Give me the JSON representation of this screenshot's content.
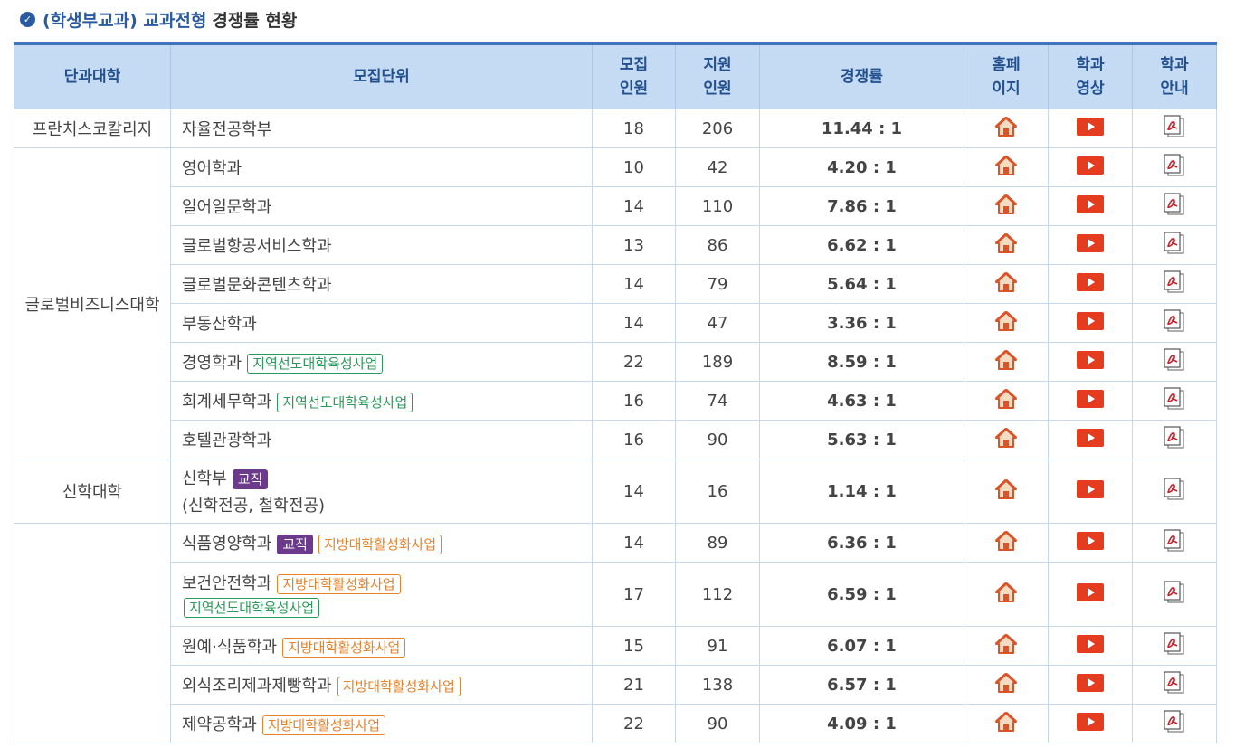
{
  "title": {
    "prefix": "(학생부교과) 교과전형",
    "suffix": "경쟁률 현황"
  },
  "headers": {
    "college": "단과대학",
    "unit": "모집단위",
    "quota_1": "모집",
    "quota_2": "인원",
    "applicants_1": "지원",
    "applicants_2": "인원",
    "rate": "경쟁률",
    "home_1": "홈페",
    "home_2": "이지",
    "video_1": "학과",
    "video_2": "영상",
    "guide_1": "학과",
    "guide_2": "안내"
  },
  "colors": {
    "header_bg": "#c5dbf3",
    "header_text": "#23508f",
    "top_border": "#3f73bb",
    "badge_green": "#2a9a5a",
    "badge_orange": "#e6822c",
    "badge_purple": "#6b3a8c",
    "home_icon": "#e0602a",
    "video_icon": "#e53b1f"
  },
  "icons": {
    "home": "home-icon",
    "video": "video-play-icon",
    "guide": "pdf-document-icon"
  },
  "colleges": [
    "프란치스코칼리지",
    "글로벌비즈니스대학",
    "신학대학",
    ""
  ],
  "rows": [
    {
      "college": "프란치스코칼리지",
      "dept": "자율전공학부",
      "quota": "18",
      "applicants": "206",
      "rate": "11.44 : 1",
      "badges": []
    },
    {
      "college": "글로벌비즈니스대학",
      "dept": "영어학과",
      "quota": "10",
      "applicants": "42",
      "rate": "4.20 : 1",
      "badges": []
    },
    {
      "college": "글로벌비즈니스대학",
      "dept": "일어일문학과",
      "quota": "14",
      "applicants": "110",
      "rate": "7.86 : 1",
      "badges": []
    },
    {
      "college": "글로벌비즈니스대학",
      "dept": "글로벌항공서비스학과",
      "quota": "13",
      "applicants": "86",
      "rate": "6.62 : 1",
      "badges": []
    },
    {
      "college": "글로벌비즈니스대학",
      "dept": "글로벌문화콘텐츠학과",
      "quota": "14",
      "applicants": "79",
      "rate": "5.64 : 1",
      "badges": []
    },
    {
      "college": "글로벌비즈니스대학",
      "dept": "부동산학과",
      "quota": "14",
      "applicants": "47",
      "rate": "3.36 : 1",
      "badges": []
    },
    {
      "college": "글로벌비즈니스대학",
      "dept": "경영학과",
      "quota": "22",
      "applicants": "189",
      "rate": "8.59 : 1",
      "badges": [
        {
          "text": "지역선도대학육성사업",
          "style": "green"
        }
      ]
    },
    {
      "college": "글로벌비즈니스대학",
      "dept": "회계세무학과",
      "quota": "16",
      "applicants": "74",
      "rate": "4.63 : 1",
      "badges": [
        {
          "text": "지역선도대학육성사업",
          "style": "green"
        }
      ]
    },
    {
      "college": "글로벌비즈니스대학",
      "dept": "호텔관광학과",
      "quota": "16",
      "applicants": "90",
      "rate": "5.63 : 1",
      "badges": []
    },
    {
      "college": "신학대학",
      "dept": "신학부",
      "dept_note": "(신학전공, 철학전공)",
      "quota": "14",
      "applicants": "16",
      "rate": "1.14 : 1",
      "badges": [
        {
          "text": "교직",
          "style": "purple"
        }
      ]
    },
    {
      "college": "",
      "dept": "식품영양학과",
      "quota": "14",
      "applicants": "89",
      "rate": "6.36 : 1",
      "badges": [
        {
          "text": "교직",
          "style": "purple"
        },
        {
          "text": "지방대학활성화사업",
          "style": "orange"
        }
      ]
    },
    {
      "college": "",
      "dept": "보건안전학과",
      "quota": "17",
      "applicants": "112",
      "rate": "6.59 : 1",
      "badges": [
        {
          "text": "지방대학활성화사업",
          "style": "orange"
        }
      ],
      "badges_line2": [
        {
          "text": "지역선도대학육성사업",
          "style": "green"
        }
      ]
    },
    {
      "college": "",
      "dept": "원예·식품학과",
      "quota": "15",
      "applicants": "91",
      "rate": "6.07 : 1",
      "badges": [
        {
          "text": "지방대학활성화사업",
          "style": "orange"
        }
      ]
    },
    {
      "college": "",
      "dept": "외식조리제과제빵학과",
      "quota": "21",
      "applicants": "138",
      "rate": "6.57 : 1",
      "badges": [
        {
          "text": "지방대학활성화사업",
          "style": "orange"
        }
      ]
    },
    {
      "college": "",
      "dept": "제약공학과",
      "quota": "22",
      "applicants": "90",
      "rate": "4.09 : 1",
      "badges": [
        {
          "text": "지방대학활성화사업",
          "style": "orange"
        }
      ]
    }
  ]
}
